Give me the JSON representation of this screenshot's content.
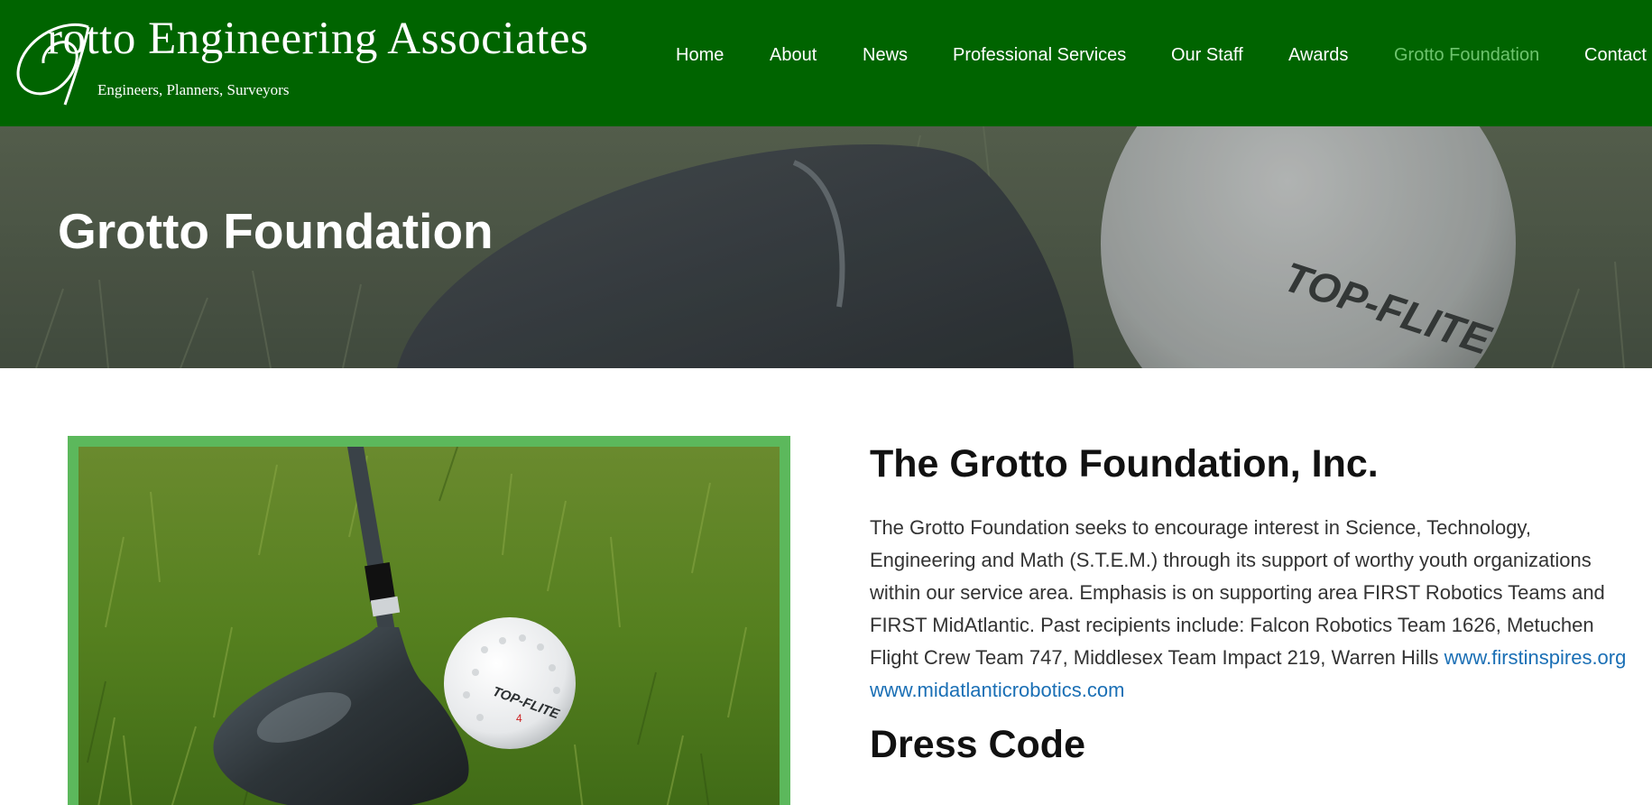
{
  "brand": {
    "name": "Grotto Engineering Associates",
    "name_rest": "rotto Engineering Associates",
    "tagline": "Engineers, Planners, Surveyors",
    "header_color": "#006400"
  },
  "nav": {
    "items": [
      {
        "label": "Home"
      },
      {
        "label": "About"
      },
      {
        "label": "News"
      },
      {
        "label": "Professional Services"
      },
      {
        "label": "Our Staff"
      },
      {
        "label": "Awards"
      },
      {
        "label": "Grotto Foundation",
        "active": true
      },
      {
        "label": "Contact"
      }
    ],
    "active_color": "#6ec46e"
  },
  "hero": {
    "title": "Grotto Foundation"
  },
  "content": {
    "heading": "The Grotto Foundation, Inc.",
    "paragraph": "The Grotto Foundation seeks to encourage interest in Science, Technology, Engineering and Math (S.T.E.M.) through its support of worthy youth organizations within our service area. Emphasis is on supporting area FIRST Robotics Teams and FIRST MidAtlantic. Past recipients include: Falcon Robotics Team 1626, Metuchen Flight Crew Team 747, Middlesex Team Impact 219, Warren Hills",
    "link1": "www.firstinspires.org",
    "link2": "www.midatlanticrobotics.com",
    "subheading": "Dress Code",
    "link_color": "#1a6fb5",
    "frame_color": "#5cb85c"
  },
  "images": {
    "hero_image": "golf-club-and-ball-photo",
    "content_image": "golf-club-and-ball-photo",
    "ball_brand": "TOP-FLITE",
    "ball_number": "4"
  }
}
